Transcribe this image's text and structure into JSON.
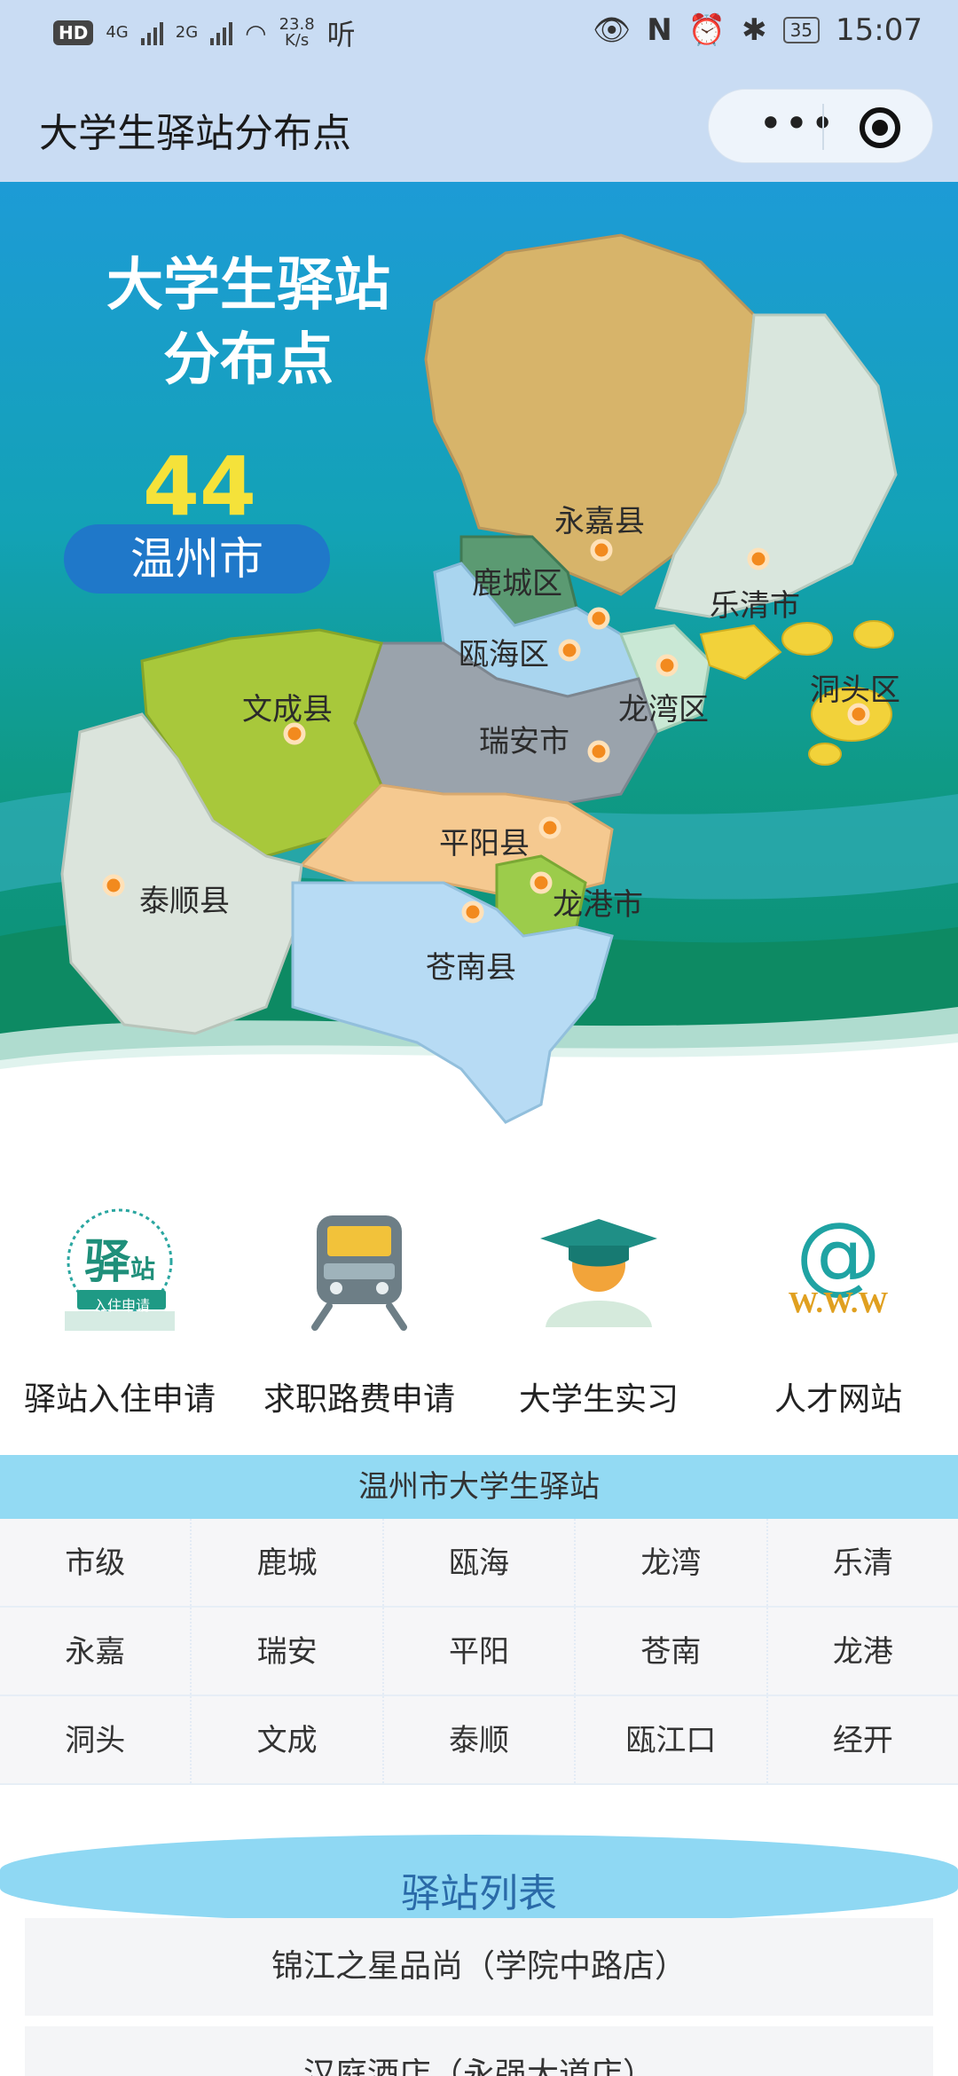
{
  "status_bar": {
    "hd": "HD",
    "net1": "4G",
    "net2": "2G",
    "speed_value": "23.8",
    "speed_unit": "K/s",
    "listen": "听",
    "time": "15:07",
    "battery": "35"
  },
  "header": {
    "title": "大学生驿站分布点",
    "more_label": "•••"
  },
  "hero": {
    "title_line1": "大学生驿站",
    "title_line2": "分布点",
    "count": "44",
    "city": "温州市",
    "regions": {
      "yongjia": "永嘉县",
      "lucheng": "鹿城区",
      "ouhai": "瓯海区",
      "yueqing": "乐清市",
      "longwan": "龙湾区",
      "dongtou": "洞头区",
      "wencheng": "文成县",
      "ruian": "瑞安市",
      "pingyang": "平阳县",
      "taishun": "泰顺县",
      "longgang": "龙港市",
      "cangnan": "苍南县"
    }
  },
  "services": [
    {
      "label": "驿站入住申请",
      "icon": "station-apply-icon",
      "badge_main": "驿",
      "badge_sub": "站",
      "badge_caption": "入住申请"
    },
    {
      "label": "求职路费申请",
      "icon": "train-icon"
    },
    {
      "label": "大学生实习",
      "icon": "graduate-icon"
    },
    {
      "label": "人才网站",
      "icon": "www-icon",
      "art_text": "W.W.W"
    }
  ],
  "stations_title": "温州市大学生驿站",
  "districts": [
    [
      "市级",
      "鹿城",
      "瓯海",
      "龙湾",
      "乐清"
    ],
    [
      "永嘉",
      "瑞安",
      "平阳",
      "苍南",
      "龙港"
    ],
    [
      "洞头",
      "文成",
      "泰顺",
      "瓯江口",
      "经开"
    ]
  ],
  "list_title": "驿站列表",
  "list_items": [
    "锦江之星品尚（学院中路店）",
    "汉庭酒店（永强大道店）"
  ],
  "colors": {
    "header_bg": "#c9dcf3",
    "sea_top": "#1d9bd6",
    "sea_bottom": "#0a8a6a",
    "count": "#f5e23a",
    "city_pill": "#1f78c9",
    "subhead_bg": "#93daf3",
    "list_title": "#2a6aa8"
  }
}
